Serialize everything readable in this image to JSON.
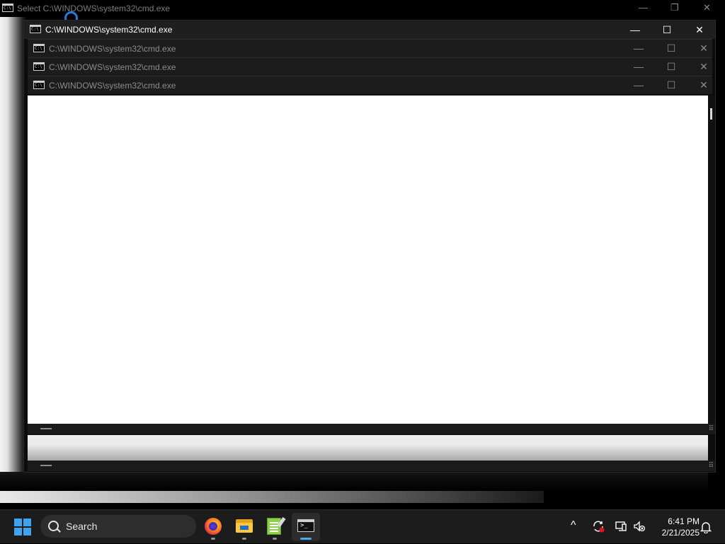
{
  "background_window": {
    "title": "Select C:\\WINDOWS\\system32\\cmd.exe",
    "controls": [
      "—",
      "❐",
      "✕"
    ]
  },
  "main_window": {
    "title": "C:\\WINDOWS\\system32\\cmd.exe",
    "controls": [
      "—",
      "☐",
      "✕"
    ]
  },
  "sub_windows": [
    {
      "title": "C:\\WINDOWS\\system32\\cmd.exe",
      "controls": [
        "—",
        "☐",
        "✕"
      ]
    },
    {
      "title": "C:\\WINDOWS\\system32\\cmd.exe",
      "controls": [
        "—",
        "☐",
        "✕"
      ]
    },
    {
      "title": "C:\\WINDOWS\\system32\\cmd.exe",
      "controls": [
        "—",
        "☐",
        "✕"
      ]
    }
  ],
  "taskbar": {
    "search_label": "Search",
    "apps": [
      {
        "name": "firefox-icon",
        "active": false
      },
      {
        "name": "file-explorer-icon",
        "active": false
      },
      {
        "name": "notepad-plus-plus-icon",
        "active": false
      },
      {
        "name": "terminal-icon",
        "active": true
      }
    ],
    "tray": {
      "chevron": "^",
      "clock_time": "6:41 PM",
      "clock_date": "2/21/2025"
    }
  },
  "colors": {
    "accent": "#3ea4f0",
    "cursor_ring": "#2b7ad9",
    "taskbar_bg": "#1c1c1c",
    "titlebar_bg": "#1f1f1f"
  }
}
